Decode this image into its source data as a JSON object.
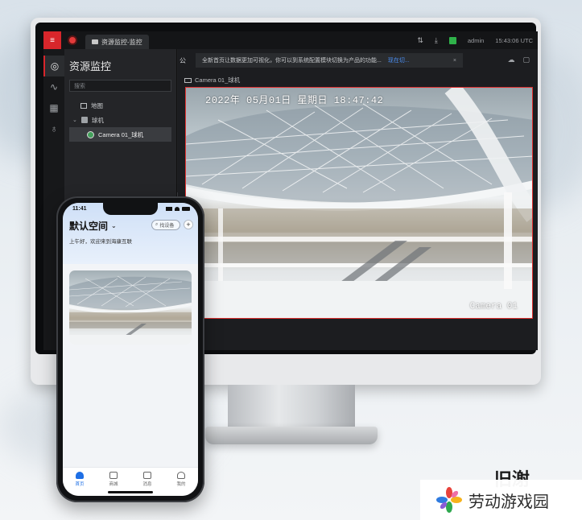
{
  "desktop": {
    "app_tab_title": "资源监控-监控",
    "user": "admin",
    "clock": "15:43:06 UTC",
    "panel": {
      "title": "资源监控",
      "search_placeholder": "搜索",
      "tree": [
        {
          "label": "地图",
          "icon": "map-icon"
        },
        {
          "label": "球机",
          "icon": "dome-camera-icon"
        },
        {
          "label": "Camera 01_球机",
          "icon": "camera-online-icon",
          "selected": true
        }
      ]
    },
    "notice": {
      "prefix": "公",
      "text": "全新首页让数据更加可视化，你可以到系统配置模块切换为产品的功能...",
      "link": "现在切...",
      "close": "×"
    },
    "camera_label": "Camera 01_球机",
    "video": {
      "osd_time": "2022年 05月01日 星期日 18:47:42",
      "osd_name": "Camera 01",
      "border_color": "#e0302f"
    },
    "accent_color": "#d8262b"
  },
  "phone": {
    "time": "11:41",
    "space_title": "默认空间",
    "search_label": "找设备",
    "add_label": "+",
    "greeting": "上午好，欢迎来到海康互联",
    "tabs": [
      {
        "label": "首页",
        "icon": "home-icon",
        "active": true
      },
      {
        "label": "商城",
        "icon": "store-icon",
        "active": false
      },
      {
        "label": "消息",
        "icon": "message-icon",
        "active": false
      },
      {
        "label": "我的",
        "icon": "profile-icon",
        "active": false
      }
    ],
    "accent_color": "#1f6fe5"
  },
  "watermark": {
    "partial_text": "旧㴬",
    "text": "劳动游戏园"
  }
}
